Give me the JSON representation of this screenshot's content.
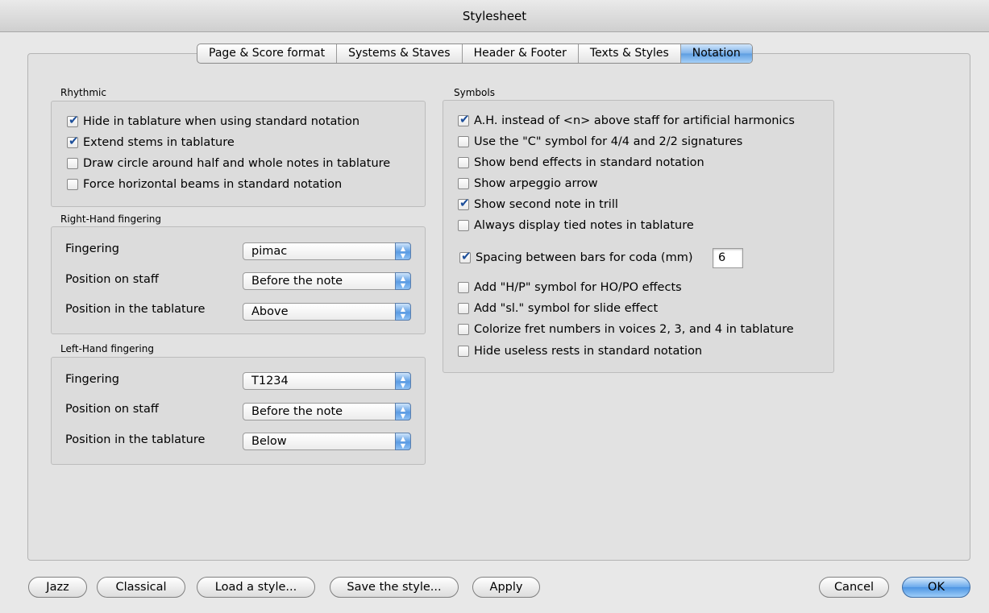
{
  "window": {
    "title": "Stylesheet"
  },
  "tabs": [
    {
      "label": "Page & Score format"
    },
    {
      "label": "Systems & Staves"
    },
    {
      "label": "Header & Footer"
    },
    {
      "label": "Texts & Styles"
    },
    {
      "label": "Notation",
      "active": true
    }
  ],
  "rhythmic": {
    "label": "Rhythmic",
    "items": [
      {
        "label": "Hide in tablature when using standard notation",
        "checked": true
      },
      {
        "label": "Extend stems in tablature",
        "checked": true
      },
      {
        "label": "Draw circle around half and whole notes in tablature",
        "checked": false
      },
      {
        "label": "Force horizontal beams in standard notation",
        "checked": false
      }
    ]
  },
  "right_hand": {
    "label": "Right-Hand fingering",
    "fingering_label": "Fingering",
    "fingering_value": "pimac",
    "staff_label": "Position on staff",
    "staff_value": "Before the note",
    "tab_label": "Position in the tablature",
    "tab_value": "Above"
  },
  "left_hand": {
    "label": "Left-Hand fingering",
    "fingering_label": "Fingering",
    "fingering_value": "T1234",
    "staff_label": "Position on staff",
    "staff_value": "Before the note",
    "tab_label": "Position in the tablature",
    "tab_value": "Below"
  },
  "symbols": {
    "label": "Symbols",
    "items": [
      {
        "label": "A.H. instead of <n> above staff for artificial harmonics",
        "checked": true
      },
      {
        "label": "Use the \"C\" symbol for 4/4 and 2/2 signatures",
        "checked": false
      },
      {
        "label": "Show bend effects in standard notation",
        "checked": false
      },
      {
        "label": "Show arpeggio arrow",
        "checked": false
      },
      {
        "label": "Show second note in trill",
        "checked": true
      },
      {
        "label": "Always display tied notes in tablature",
        "checked": false
      }
    ],
    "coda": {
      "label": "Spacing between bars for coda (mm)",
      "checked": true,
      "value": "6"
    },
    "items2": [
      {
        "label": "Add \"H/P\" symbol for HO/PO effects",
        "checked": false
      },
      {
        "label": "Add \"sl.\" symbol for slide effect",
        "checked": false
      },
      {
        "label": "Colorize fret numbers in voices 2, 3, and 4 in tablature",
        "checked": false
      },
      {
        "label": "Hide useless rests in standard notation",
        "checked": false
      }
    ]
  },
  "buttons": {
    "jazz": "Jazz",
    "classical": "Classical",
    "load": "Load a style...",
    "save": "Save the style...",
    "apply": "Apply",
    "cancel": "Cancel",
    "ok": "OK"
  },
  "colors": {
    "accent": "#5d9de1",
    "window_bg": "#e8e8e8",
    "group_bg": "#dcdcdc"
  }
}
